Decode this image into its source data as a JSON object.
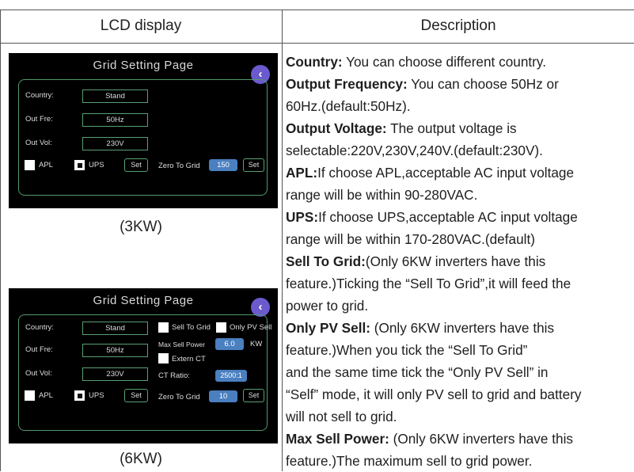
{
  "header": {
    "lcd_col": "LCD display",
    "desc_col": "Description"
  },
  "lcd_3kw": {
    "title": "Grid Setting Page",
    "back_icon": "‹",
    "country_label": "Country:",
    "country_value": "Stand",
    "freq_label": "Out Fre:",
    "freq_value": "50Hz",
    "vol_label": "Out Vol:",
    "vol_value": "230V",
    "apl_label": "APL",
    "ups_label": "UPS",
    "set_label": "Set",
    "zero_label": "Zero To Grid",
    "zero_value": "150",
    "set2_label": "Set",
    "caption": "(3KW)"
  },
  "lcd_6kw": {
    "title": "Grid Setting Page",
    "back_icon": "‹",
    "country_label": "Country:",
    "country_value": "Stand",
    "freq_label": "Out Fre:",
    "freq_value": "50Hz",
    "vol_label": "Out Vol:",
    "vol_value": "230V",
    "sell_label": "Sell To Grid",
    "only_pv_label": "Only PV Sell",
    "max_sell_label": "Max Sell Power",
    "max_sell_value": "6.0",
    "max_sell_unit": "KW",
    "extern_ct_label": "Extern CT",
    "ct_ratio_label": "CT Ratio:",
    "ct_ratio_value": "2500:1",
    "apl_label": "APL",
    "ups_label": "UPS",
    "set_label": "Set",
    "zero_label": "Zero To Grid",
    "zero_value": "10",
    "set2_label": "Set",
    "caption": "(6KW)"
  },
  "description": {
    "l1_b": "Country:",
    "l1_t": " You can choose different country.",
    "l2_b": "Output Frequency:",
    "l2_t": " You can choose 50Hz or",
    "l3_t": "60Hz.(default:50Hz).",
    "l4_b": "Output Voltage:",
    "l4_t": " The output voltage is",
    "l5_t": "selectable:220V,230V,240V.(default:230V).",
    "l6_b": "APL:",
    "l6_t": "If choose APL,acceptable AC input voltage",
    "l7_t": "range will be within 90-280VAC.",
    "l8_b": "UPS:",
    "l8_t": "If choose UPS,acceptable AC input voltage",
    "l9_t": "range will be within 170-280VAC.(default)",
    "l10_b": "Sell To Grid:",
    "l10_t": "(Only 6KW inverters have this",
    "l11_t": "feature.)Ticking the “Sell To Grid”,it will feed the",
    "l12_t": "power to grid.",
    "l13_b": "Only PV Sell:",
    "l13_t": " (Only 6KW inverters have this",
    "l14_t": "feature.)When you tick the “Sell To Grid”",
    "l15_t": "and the same time tick the “Only PV Sell” in",
    "l16_t": "“Self” mode, it will only PV sell to grid and battery",
    "l17_t": "will not sell to grid.",
    "l18_b": "Max Sell Power:",
    "l18_t": " (Only 6KW inverters have this",
    "l19_t": "feature.)The maximum sell to grid power."
  }
}
